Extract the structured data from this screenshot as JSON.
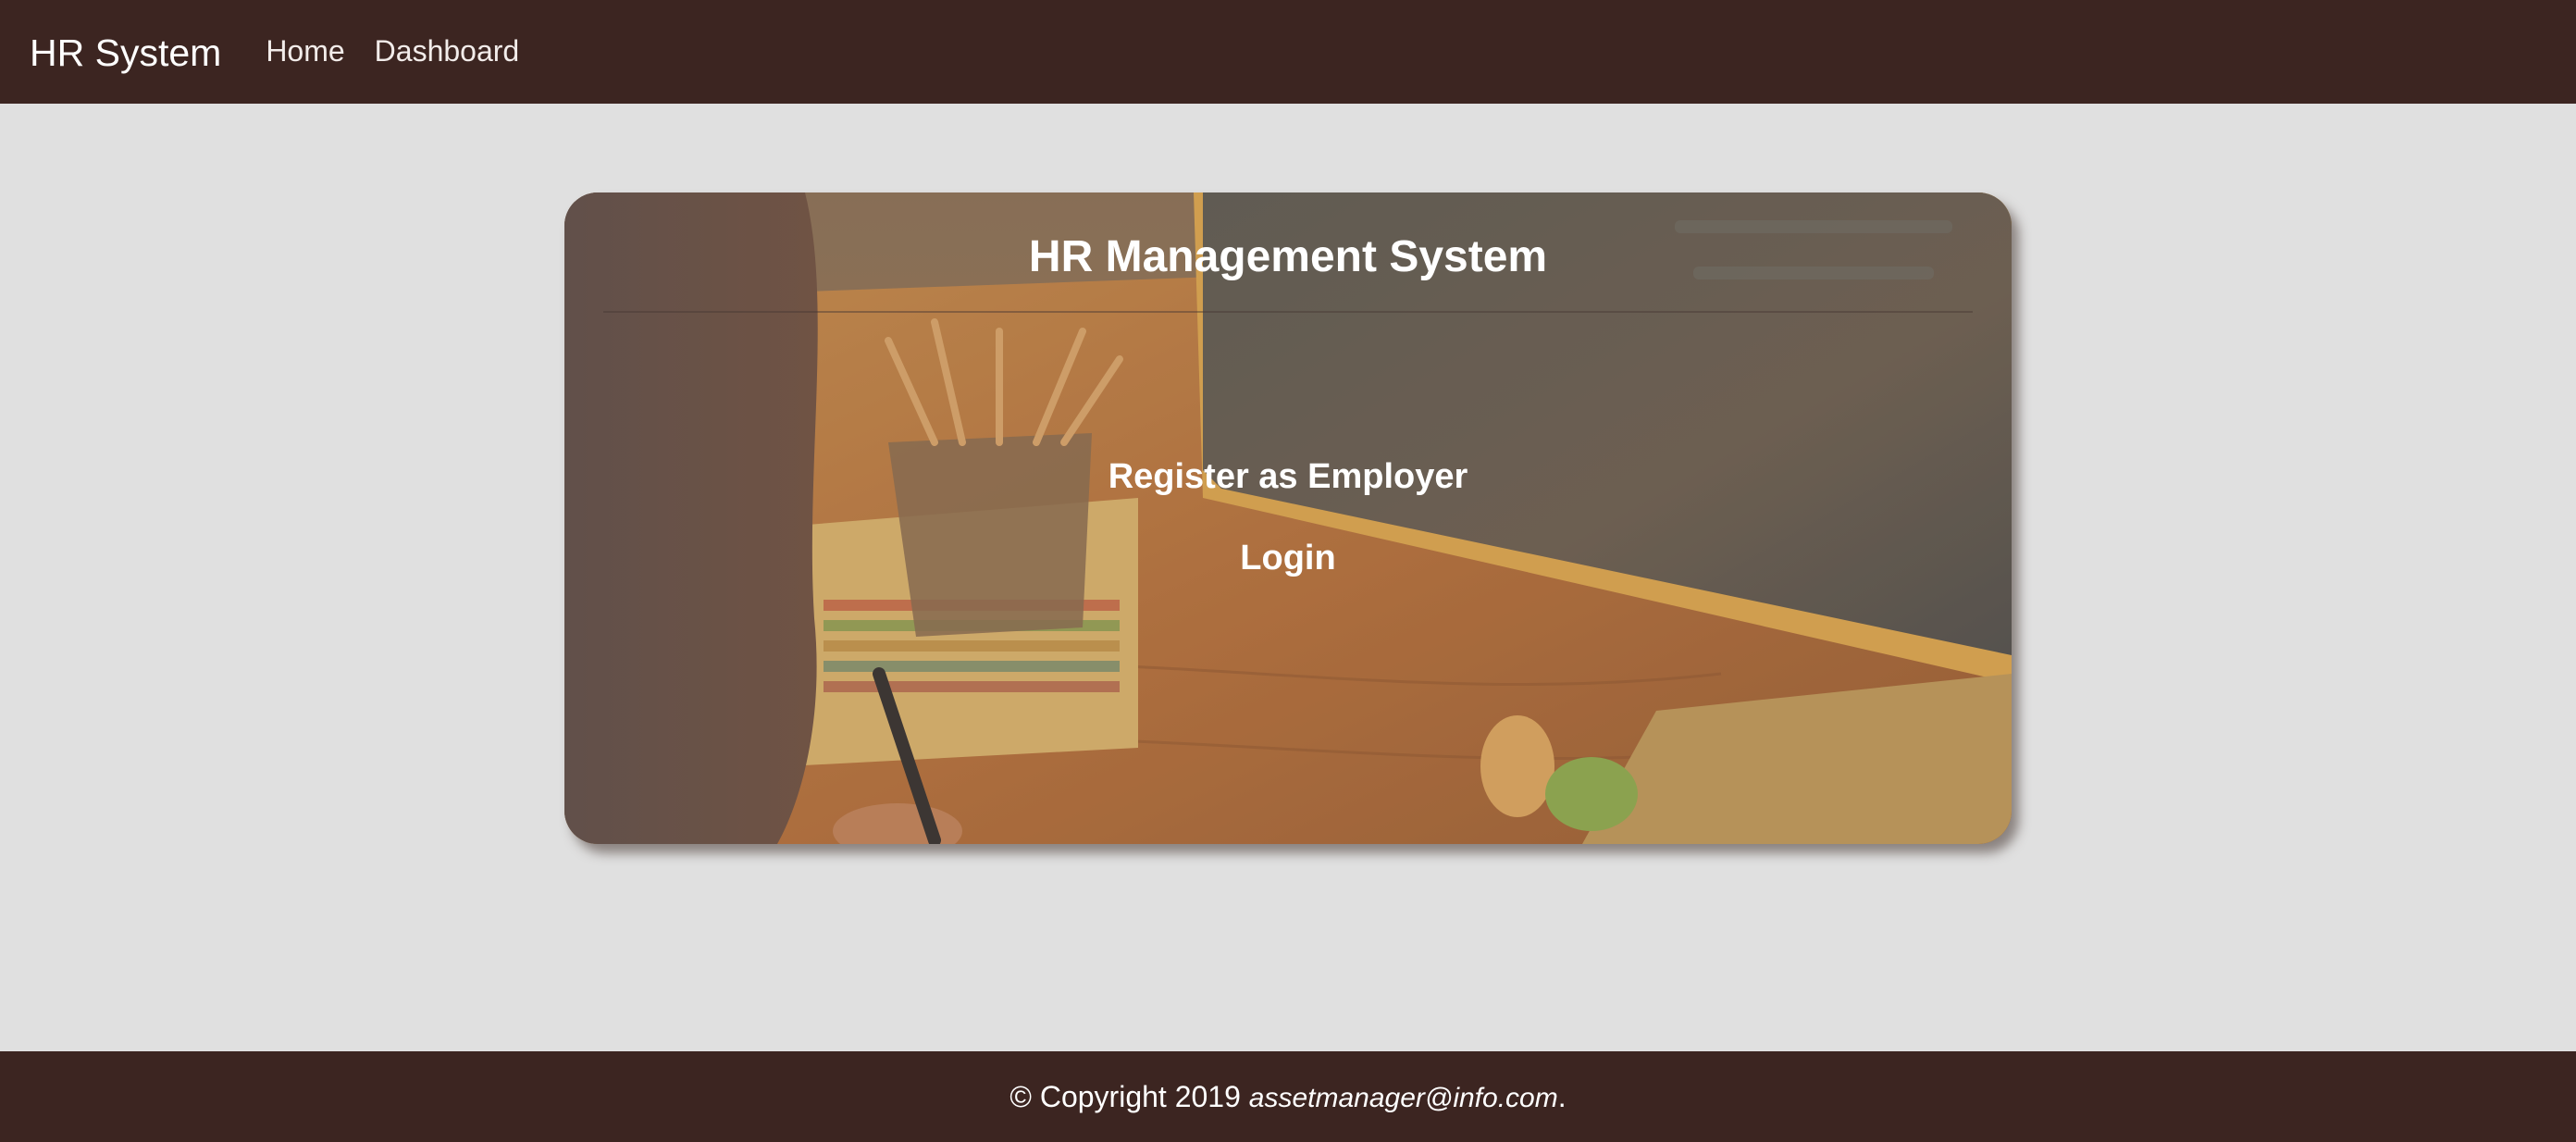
{
  "navbar": {
    "brand": "HR System",
    "links": [
      "Home",
      "Dashboard"
    ]
  },
  "card": {
    "title": "HR Management System",
    "actions": {
      "register": "Register as Employer",
      "login": "Login"
    }
  },
  "footer": {
    "copyright": "© Copyright 2019",
    "email": "assetmanager@info.com",
    "end": "."
  },
  "colors": {
    "header_bg": "#3c2521",
    "page_bg": "#e0e0e0",
    "text_light": "#ffffff"
  }
}
